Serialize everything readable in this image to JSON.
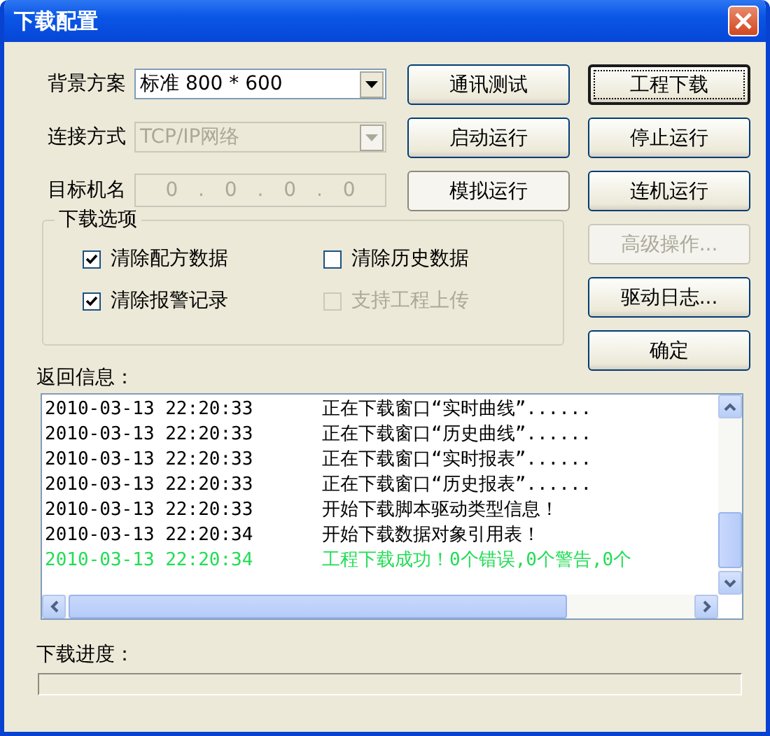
{
  "window": {
    "title": "下载配置"
  },
  "fields": [
    {
      "label": "背景方案",
      "kind": "combo",
      "value": "标准 800 * 600",
      "disabled": false
    },
    {
      "label": "连接方式",
      "kind": "combo",
      "value": "TCP/IP网络",
      "disabled": true
    },
    {
      "label": "目标机名",
      "kind": "ip",
      "octets": [
        "0",
        "0",
        "0",
        "0"
      ],
      "separator": ".",
      "disabled": true
    }
  ],
  "buttons": [
    {
      "label": "通讯测试",
      "disabled": false,
      "default": false,
      "pressed": false
    },
    {
      "label": "工程下载",
      "disabled": false,
      "default": true,
      "pressed": false
    },
    {
      "label": "启动运行",
      "disabled": false,
      "default": false,
      "pressed": false
    },
    {
      "label": "停止运行",
      "disabled": false,
      "default": false,
      "pressed": false
    },
    {
      "label": "模拟运行",
      "disabled": false,
      "default": false,
      "pressed": true
    },
    {
      "label": "连机运行",
      "disabled": false,
      "default": false,
      "pressed": false
    },
    {
      "label": "高级操作...",
      "disabled": true,
      "default": false,
      "pressed": false
    },
    {
      "label": "驱动日志...",
      "disabled": false,
      "default": false,
      "pressed": false
    },
    {
      "label": "确定",
      "disabled": false,
      "default": false,
      "pressed": false
    }
  ],
  "download_options": {
    "title": "下载选项",
    "options": [
      {
        "label": "清除配方数据",
        "checked": true,
        "disabled": false
      },
      {
        "label": "清除历史数据",
        "checked": false,
        "disabled": false
      },
      {
        "label": "清除报警记录",
        "checked": true,
        "disabled": false
      },
      {
        "label": "支持工程上传",
        "checked": false,
        "disabled": true
      }
    ]
  },
  "log": {
    "label": "返回信息：",
    "rows": [
      {
        "time": "2010-03-13 22:20:33",
        "message": "正在下载窗口“实时曲线”......",
        "kind": "info"
      },
      {
        "time": "2010-03-13 22:20:33",
        "message": "正在下载窗口“历史曲线”......",
        "kind": "info"
      },
      {
        "time": "2010-03-13 22:20:33",
        "message": "正在下载窗口“实时报表”......",
        "kind": "info"
      },
      {
        "time": "2010-03-13 22:20:33",
        "message": "正在下载窗口“历史报表”......",
        "kind": "info"
      },
      {
        "time": "2010-03-13 22:20:33",
        "message": "开始下载脚本驱动类型信息！",
        "kind": "info"
      },
      {
        "time": "2010-03-13 22:20:34",
        "message": "开始下载数据对象引用表！",
        "kind": "info"
      },
      {
        "time": "2010-03-13 22:20:34",
        "message": "工程下载成功！0个错误,0个警告,0个",
        "kind": "success"
      }
    ]
  },
  "progress": {
    "label": "下载进度："
  }
}
